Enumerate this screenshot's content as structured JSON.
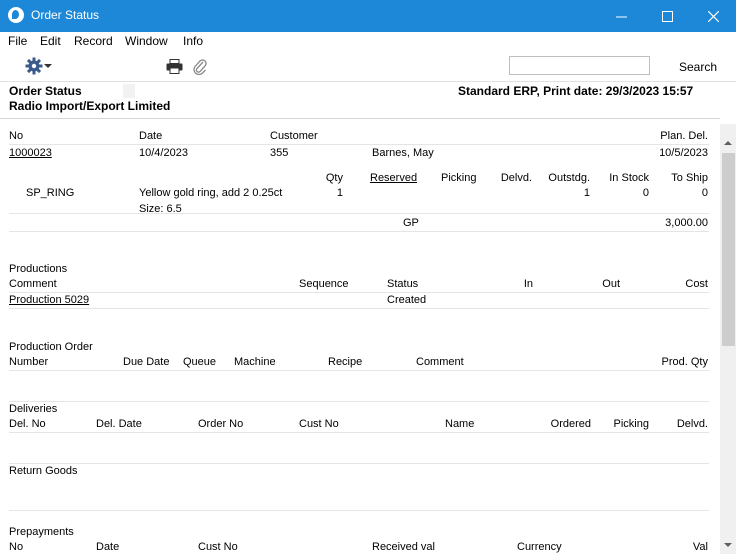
{
  "window": {
    "title": "Order Status"
  },
  "menu": [
    "File",
    "Edit",
    "Record",
    "Window",
    "Info"
  ],
  "toolbar": {
    "search_value": "",
    "search_label": "Search"
  },
  "report": {
    "title": "Order Status",
    "company": "Radio Import/Export Limited",
    "print_info": "Standard ERP, Print date: 29/3/2023 15:57"
  },
  "order_header": {
    "columns": {
      "no": "No",
      "date": "Date",
      "customer": "Customer",
      "plan_del": "Plan. Del."
    },
    "row": {
      "no": "1000023",
      "date": "10/4/2023",
      "customer_code": "355",
      "customer_name": "Barnes, May",
      "plan_del": "10/5/2023"
    }
  },
  "items": {
    "columns": {
      "qty": "Qty",
      "reserved": "Reserved",
      "picking": "Picking",
      "delvd": "Delvd.",
      "outstdg": "Outstdg.",
      "in_stock": "In Stock",
      "to_ship": "To Ship"
    },
    "rows": [
      {
        "code": "SP_RING",
        "description": "Yellow gold ring, add 2 0.25ct",
        "qty": "1",
        "outstdg": "1",
        "in_stock": "0",
        "to_ship": "0",
        "size": "Size: 6.5"
      }
    ],
    "gp_label": "GP",
    "gp_value": "3,000.00"
  },
  "productions": {
    "title": "Productions",
    "columns": {
      "comment": "Comment",
      "sequence": "Sequence",
      "status": "Status",
      "in": "In",
      "out": "Out",
      "cost": "Cost"
    },
    "rows": [
      {
        "comment": "Production 5029",
        "status": "Created"
      }
    ]
  },
  "production_order": {
    "title": "Production Order",
    "columns": {
      "number": "Number",
      "due_date": "Due Date",
      "queue": "Queue",
      "machine": "Machine",
      "recipe": "Recipe",
      "comment": "Comment",
      "prod_qty": "Prod. Qty"
    }
  },
  "deliveries": {
    "title": "Deliveries",
    "columns": {
      "del_no": "Del. No",
      "del_date": "Del. Date",
      "order_no": "Order No",
      "cust_no": "Cust No",
      "name": "Name",
      "ordered": "Ordered",
      "picking": "Picking",
      "delvd": "Delvd."
    }
  },
  "return_goods": {
    "title": "Return Goods"
  },
  "prepayments": {
    "title": "Prepayments",
    "columns": {
      "no": "No",
      "date": "Date",
      "cust_no": "Cust No",
      "received_val": "Received val",
      "currency": "Currency",
      "val": "Val"
    }
  }
}
